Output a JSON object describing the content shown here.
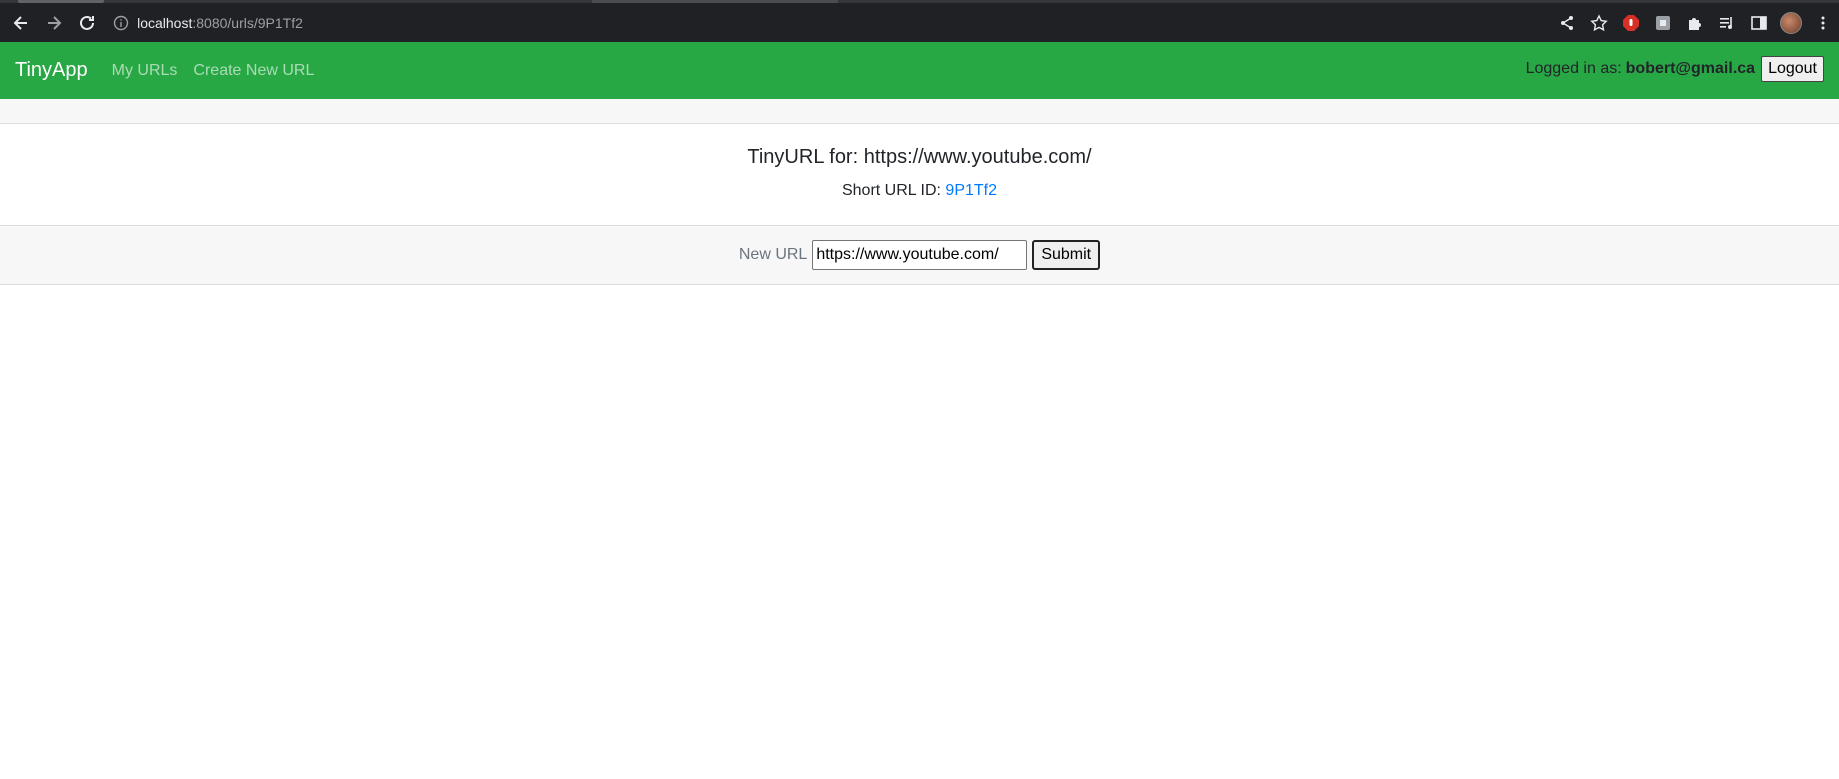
{
  "browser": {
    "url_host": "localhost",
    "url_path": ":8080/urls/9P1Tf2"
  },
  "navbar": {
    "brand": "TinyApp",
    "links": [
      "My URLs",
      "Create New URL"
    ],
    "logged_in_label": "Logged in as:",
    "user_email": "bobert@gmail.ca",
    "logout_label": "Logout",
    "color": "#28a745"
  },
  "card": {
    "title": "TinyURL for: https://www.youtube.com/",
    "short_id_label": "Short URL ID:",
    "short_id": "9P1Tf2"
  },
  "form": {
    "label": "New URL",
    "value": "https://www.youtube.com/",
    "submit_label": "Submit"
  }
}
